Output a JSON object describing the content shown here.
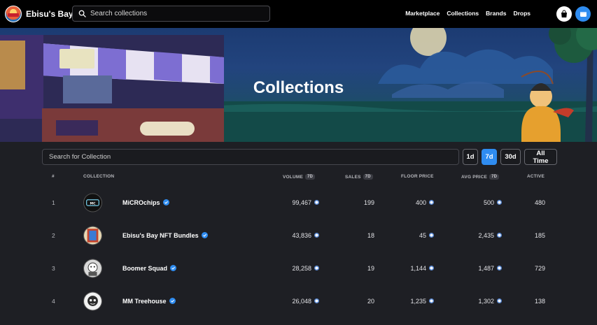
{
  "nav": {
    "brand": "Ebisu's Bay",
    "search_placeholder": "Search collections",
    "links": [
      "Marketplace",
      "Collections",
      "Brands",
      "Drops"
    ]
  },
  "hero": {
    "title": "Collections"
  },
  "filters": {
    "search_placeholder": "Search for Collection",
    "ranges": [
      "1d",
      "7d",
      "30d",
      "All Time"
    ],
    "active_range": "7d"
  },
  "table": {
    "headers": {
      "rank": "#",
      "collection": "COLLECTION",
      "volume": "VOLUME",
      "sales": "SALES",
      "floor": "FLOOR PRICE",
      "avg": "AVG PRICE",
      "active": "ACTIVE",
      "badge": "7D"
    },
    "rows": [
      {
        "rank": "1",
        "name": "MiCROchips",
        "volume": "99,467",
        "sales": "199",
        "floor": "400",
        "avg": "500",
        "active": "480"
      },
      {
        "rank": "2",
        "name": "Ebisu's Bay NFT Bundles",
        "volume": "43,836",
        "sales": "18",
        "floor": "45",
        "avg": "2,435",
        "active": "185"
      },
      {
        "rank": "3",
        "name": "Boomer Squad",
        "volume": "28,258",
        "sales": "19",
        "floor": "1,144",
        "avg": "1,487",
        "active": "729"
      },
      {
        "rank": "4",
        "name": "MM Treehouse",
        "volume": "26,048",
        "sales": "20",
        "floor": "1,235",
        "avg": "1,302",
        "active": "138"
      }
    ]
  },
  "colors": {
    "accent": "#2f8cf0",
    "background": "#1e1f24",
    "navbar": "#000000"
  }
}
